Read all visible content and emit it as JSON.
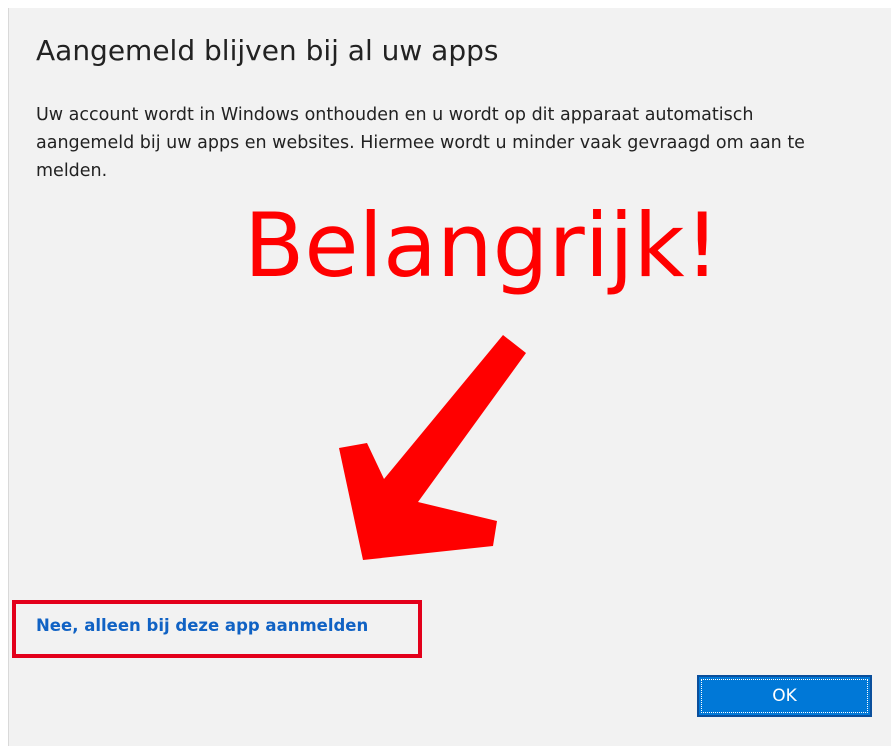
{
  "dialog": {
    "title": "Aangemeld blijven bij al uw apps",
    "body": "Uw account wordt in Windows onthouden en u wordt op dit apparaat automatisch aangemeld bij uw apps en websites. Hiermee wordt u minder vaak gevraagd om aan te melden.",
    "link_label": "Nee, alleen bij deze app aanmelden",
    "ok_label": "OK"
  },
  "annotation": {
    "text": "Belangrijk!",
    "color": "#ff0000",
    "highlight_color": "#e3001b"
  },
  "colors": {
    "link": "#1062c4",
    "button": "#0078d7",
    "background": "#f2f2f2"
  }
}
